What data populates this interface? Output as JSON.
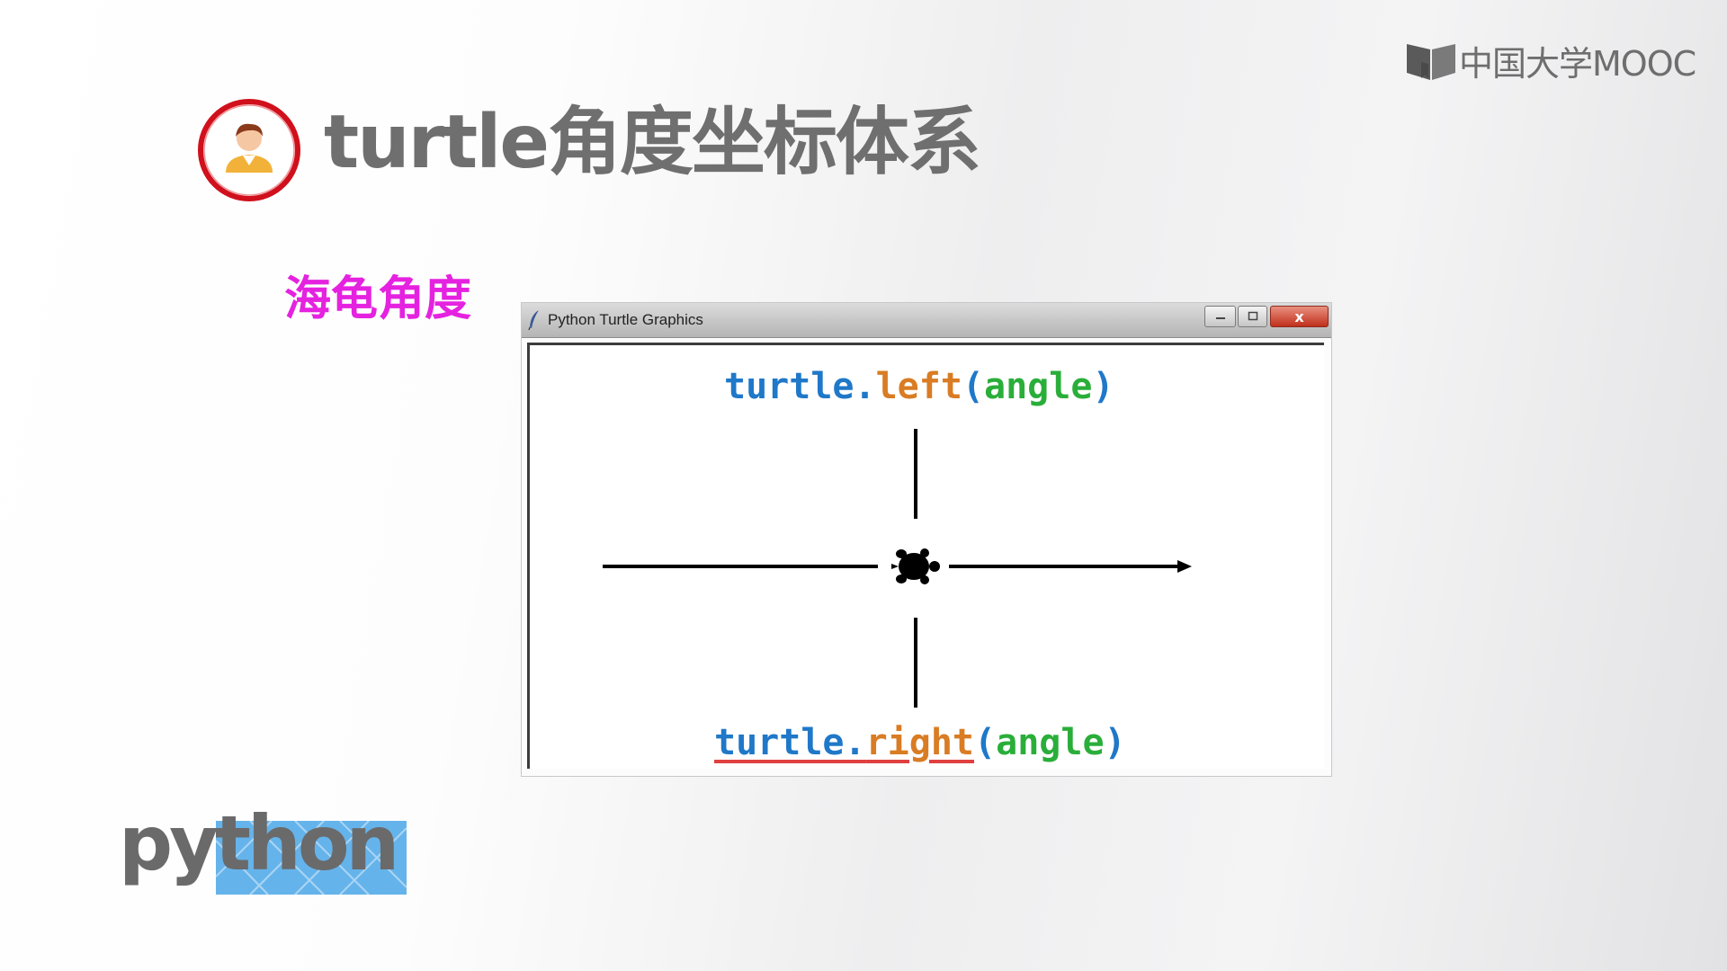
{
  "brand": {
    "mooc_logo_text": "中国大学MOOC",
    "python_logo_text": "python"
  },
  "slide": {
    "title": "turtle角度坐标体系",
    "subtitle": "海龟角度"
  },
  "window": {
    "title": "Python Turtle Graphics",
    "buttons": {
      "minimize_icon": "minimize-icon",
      "maximize_icon": "maximize-icon",
      "close_label": "x"
    },
    "canvas": {
      "top_code": {
        "module": "turtle",
        "dot": ".",
        "method": "left",
        "open_paren": "(",
        "arg": "angle",
        "close_paren": ")"
      },
      "bottom_code": {
        "module": "turtle",
        "dot": ".",
        "method": "right",
        "open_paren": "(",
        "arg": "angle",
        "close_paren": ")"
      }
    }
  },
  "colors": {
    "title": "#6f6f6f",
    "subtitle": "#e522e0",
    "code_module": "#1f78c8",
    "code_method": "#d97c24",
    "code_arg": "#2aae3a",
    "avatar_ring": "#d0101c"
  }
}
